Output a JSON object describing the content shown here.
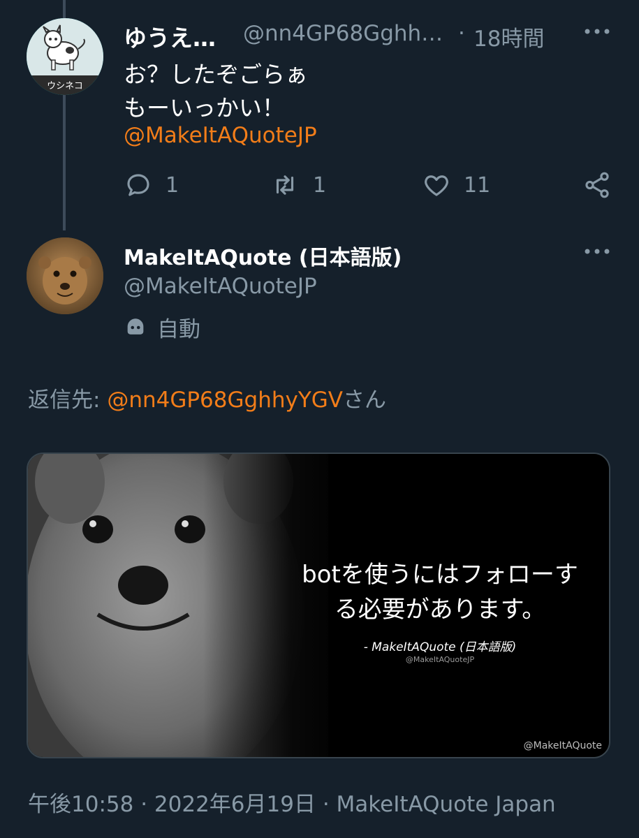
{
  "tweet1": {
    "name": "ゆうえ…",
    "handle": "@nn4GP68Gghh…",
    "separator": "·",
    "time": "18時間",
    "text_line1": "お？したぞごらぁ",
    "text_line2": "もーいっかい！",
    "mention": "@MakeItAQuoteJP",
    "avatar_label": "ウシネコ",
    "actions": {
      "replies": "1",
      "retweets": "1",
      "likes": "11"
    }
  },
  "tweet2": {
    "name": "MakeItAQuote (日本語版)",
    "handle": "@MakeItAQuoteJP",
    "automated_label": "自動",
    "reply_to_prefix": "返信先: ",
    "reply_to_mention": "@nn4GP68GghhyYGV",
    "reply_to_suffix": "さん",
    "quote_card": {
      "quote_line1": "botを使うにはフォローす",
      "quote_line2": "る必要があります。",
      "author": "- MakeItAQuote (日本語版)",
      "author_handle": "@MakeItAQuoteJP",
      "watermark": "@MakeItAQuote"
    },
    "footer": {
      "time": "午後10:58",
      "sep1": " · ",
      "date": "2022年6月19日",
      "sep2": " · ",
      "source": "MakeItAQuote Japan"
    }
  },
  "colors": {
    "background": "#15202b",
    "secondary_text": "#8899a6",
    "mention": "#f27d19",
    "thread_line": "#3d4b5a"
  },
  "icons": [
    "more-icon",
    "reply-icon",
    "retweet-icon",
    "like-icon",
    "share-icon",
    "bot-icon"
  ]
}
